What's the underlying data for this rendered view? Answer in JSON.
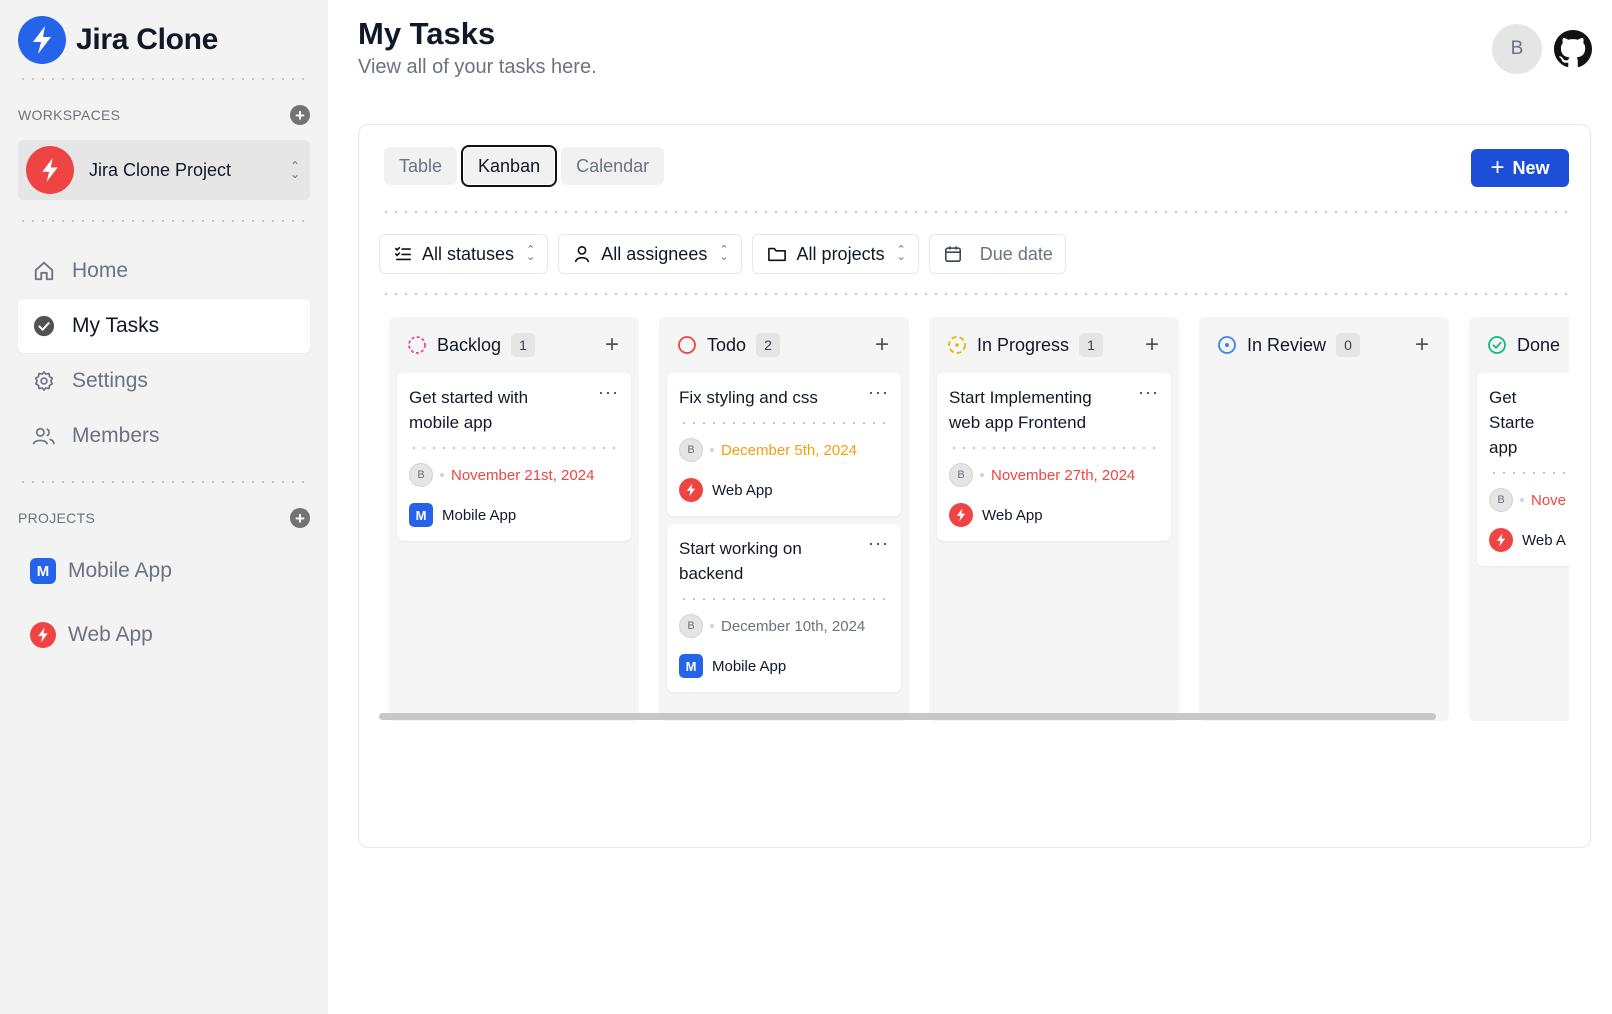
{
  "brand": {
    "name": "Jira Clone"
  },
  "sidebar": {
    "workspaces_title": "WORKSPACES",
    "workspace_name": "Jira Clone Project",
    "nav": [
      {
        "label": "Home",
        "icon": "home-icon"
      },
      {
        "label": "My Tasks",
        "icon": "check-circle-icon"
      },
      {
        "label": "Settings",
        "icon": "gear-icon"
      },
      {
        "label": "Members",
        "icon": "users-icon"
      }
    ],
    "projects_title": "PROJECTS",
    "projects": [
      {
        "initial": "M",
        "label": "Mobile App"
      },
      {
        "label": "Web App"
      }
    ]
  },
  "header": {
    "title": "My Tasks",
    "subtitle": "View all of your tasks here.",
    "user_initial": "B"
  },
  "tabs": [
    "Table",
    "Kanban",
    "Calendar"
  ],
  "active_tab": "Kanban",
  "new_button": "New",
  "filters": {
    "statuses": "All statuses",
    "assignees": "All assignees",
    "projects": "All projects",
    "due_date": "Due date"
  },
  "colors": {
    "accent": "#1d4ed8",
    "backlog": "#ec4899",
    "todo": "#ef4444",
    "in_progress": "#eab308",
    "in_review": "#3b82f6",
    "done": "#10b981"
  },
  "columns": [
    {
      "title": "Backlog",
      "count": "1",
      "tasks": [
        {
          "name": "Get started with mobile app",
          "assignee": "B",
          "due": "November 21st, 2024",
          "project": "Mobile App",
          "project_initial": "M"
        }
      ]
    },
    {
      "title": "Todo",
      "count": "2",
      "tasks": [
        {
          "name": "Fix styling and css",
          "assignee": "B",
          "due": "December 5th, 2024",
          "project": "Web App"
        },
        {
          "name": "Start working on backend",
          "assignee": "B",
          "due": "December 10th, 2024",
          "project": "Mobile App",
          "project_initial": "M"
        }
      ]
    },
    {
      "title": "In Progress",
      "count": "1",
      "tasks": [
        {
          "name": "Start Implementing web app Frontend",
          "assignee": "B",
          "due": "November 27th, 2024",
          "project": "Web App"
        }
      ]
    },
    {
      "title": "In Review",
      "count": "0",
      "tasks": []
    },
    {
      "title": "Done",
      "tasks": [
        {
          "name": "Get Starte app",
          "assignee": "B",
          "due": "Nove",
          "project": "Web A"
        }
      ]
    }
  ]
}
